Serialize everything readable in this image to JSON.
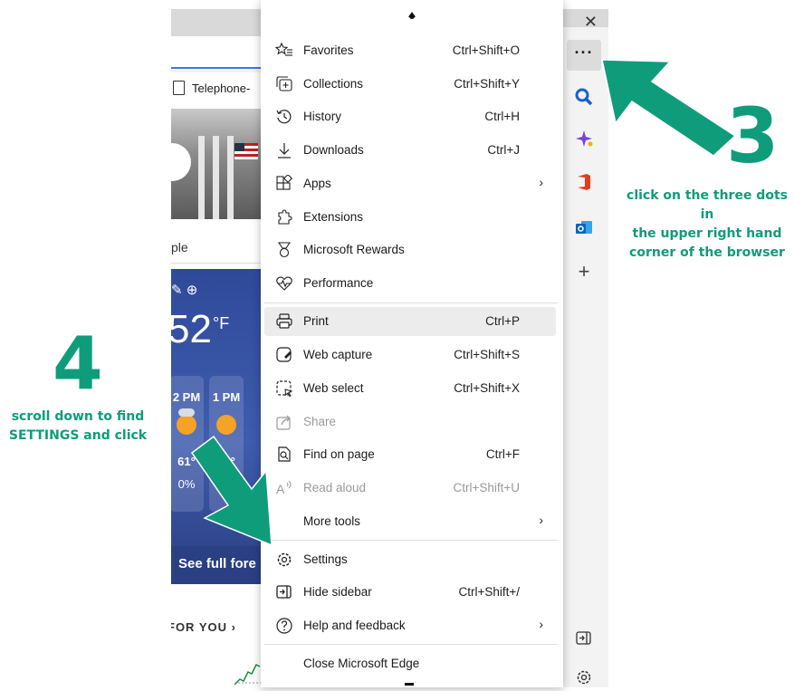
{
  "browser": {
    "close_glyph": "✕",
    "tab_title": "Telephone-",
    "search_fragment": "ple",
    "weather": {
      "temp": "52",
      "unit": "°F",
      "hours": [
        {
          "time": "2 PM",
          "temp": "61°",
          "precip": "0%"
        },
        {
          "time": "1 PM",
          "temp": "64°"
        }
      ],
      "see_full": "See full fore"
    },
    "for_you": "FOR YOU  ›"
  },
  "sidebar": {
    "more_button": "···",
    "icons": [
      "search-icon",
      "copilot-sparkle-icon",
      "office-icon",
      "outlook-icon",
      "add-icon",
      "hide-sidebar-icon",
      "settings-icon"
    ],
    "add": "+"
  },
  "menu": {
    "items": [
      {
        "label": "Favorites",
        "shortcut": "Ctrl+Shift+O"
      },
      {
        "label": "Collections",
        "shortcut": "Ctrl+Shift+Y"
      },
      {
        "label": "History",
        "shortcut": "Ctrl+H"
      },
      {
        "label": "Downloads",
        "shortcut": "Ctrl+J"
      },
      {
        "label": "Apps",
        "shortcut": ""
      },
      {
        "label": "Extensions",
        "shortcut": ""
      },
      {
        "label": "Microsoft Rewards",
        "shortcut": ""
      },
      {
        "label": "Performance",
        "shortcut": ""
      },
      {
        "label": "Print",
        "shortcut": "Ctrl+P"
      },
      {
        "label": "Web capture",
        "shortcut": "Ctrl+Shift+S"
      },
      {
        "label": "Web select",
        "shortcut": "Ctrl+Shift+X"
      },
      {
        "label": "Share",
        "shortcut": ""
      },
      {
        "label": "Find on page",
        "shortcut": "Ctrl+F"
      },
      {
        "label": "Read aloud",
        "shortcut": "Ctrl+Shift+U"
      },
      {
        "label": "More tools",
        "shortcut": ""
      },
      {
        "label": "Settings",
        "shortcut": ""
      },
      {
        "label": "Hide sidebar",
        "shortcut": "Ctrl+Shift+/"
      },
      {
        "label": "Help and feedback",
        "shortcut": ""
      },
      {
        "label": "Close Microsoft Edge",
        "shortcut": ""
      }
    ],
    "arrow": "›"
  },
  "annotations": {
    "step3": {
      "number": "3",
      "text_lines": [
        "click on the three dots in",
        "the upper right hand",
        "corner of the browser"
      ]
    },
    "step4": {
      "number": "4",
      "text_lines": [
        "scroll down to find",
        "SETTINGS and click"
      ]
    },
    "color": "#0f9c7b"
  }
}
